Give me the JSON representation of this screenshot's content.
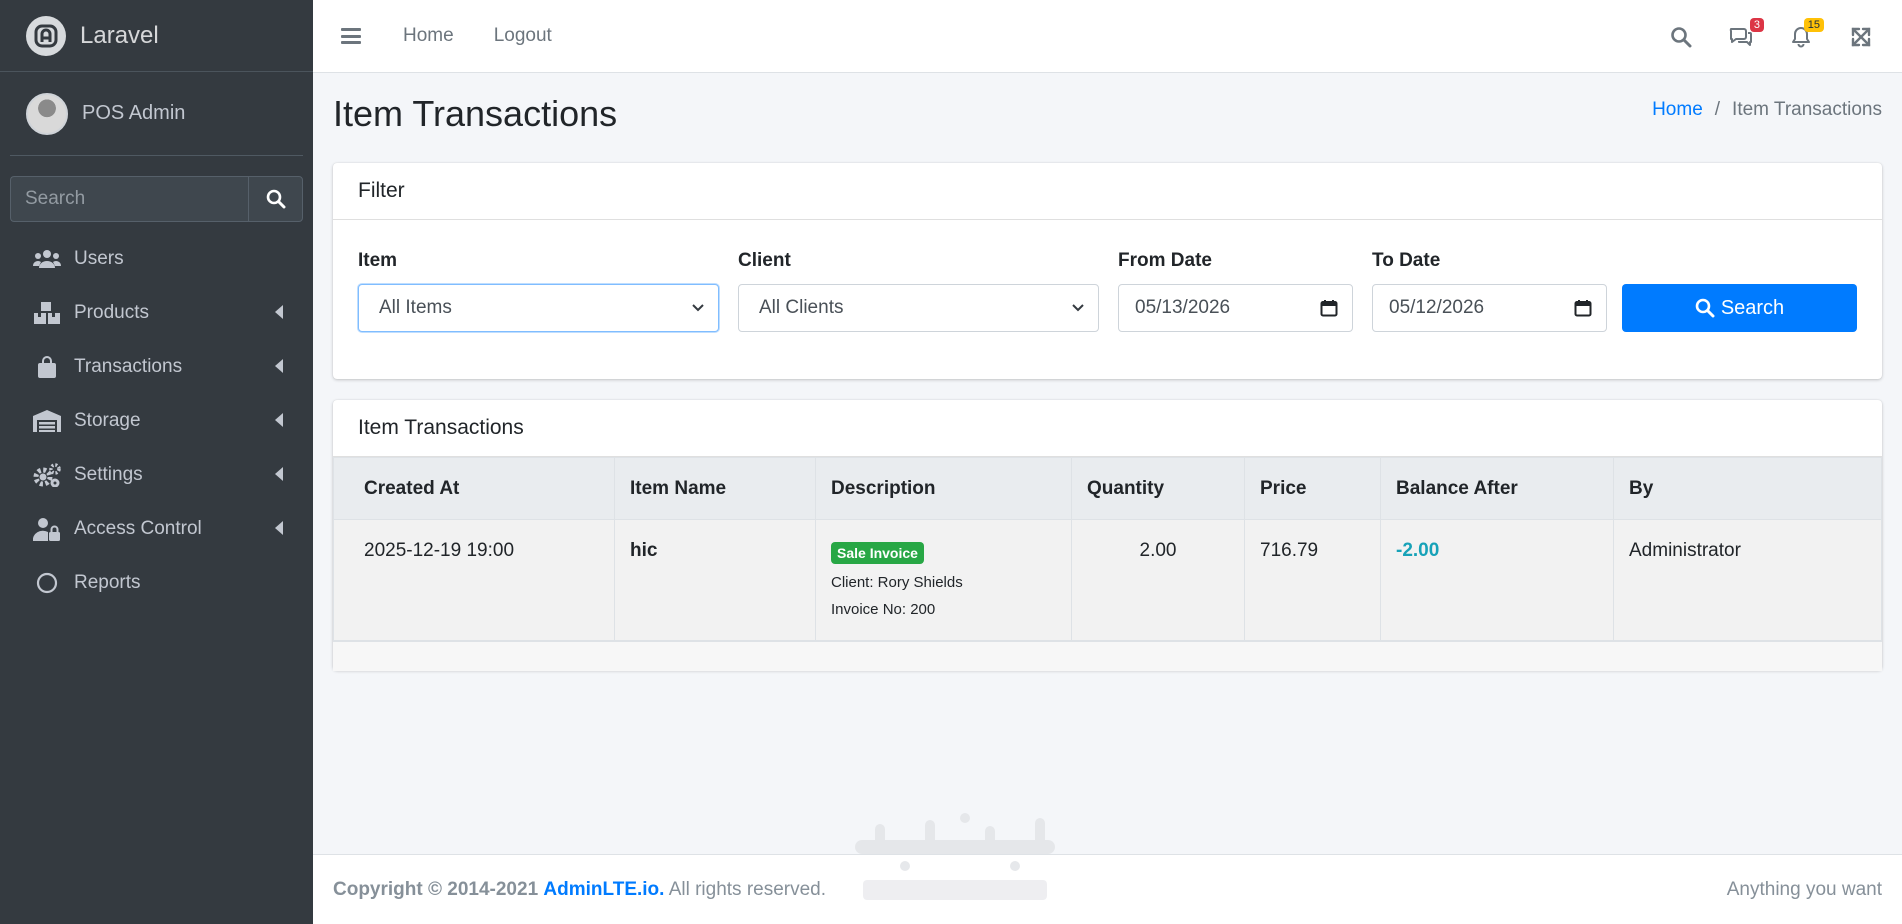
{
  "brand": {
    "name": "Laravel"
  },
  "user": {
    "name": "POS Admin"
  },
  "sidebar": {
    "search_placeholder": "Search",
    "items": [
      {
        "label": "Users",
        "icon": "users-icon",
        "has_arrow": false
      },
      {
        "label": "Products",
        "icon": "boxes-icon",
        "has_arrow": true
      },
      {
        "label": "Transactions",
        "icon": "shopping-bag-icon",
        "has_arrow": true
      },
      {
        "label": "Storage",
        "icon": "warehouse-icon",
        "has_arrow": true
      },
      {
        "label": "Settings",
        "icon": "cogs-icon",
        "has_arrow": true
      },
      {
        "label": "Access Control",
        "icon": "user-lock-icon",
        "has_arrow": true
      },
      {
        "label": "Reports",
        "icon": "circle-icon",
        "has_arrow": false
      }
    ]
  },
  "topbar": {
    "links": [
      "Home",
      "Logout"
    ],
    "messages_count": "3",
    "notifications_count": "15"
  },
  "page": {
    "title": "Item Transactions",
    "breadcrumb": [
      "Home",
      "Item Transactions"
    ]
  },
  "filter": {
    "header": "Filter",
    "item_label": "Item",
    "item_value": "All Items",
    "client_label": "Client",
    "client_value": "All Clients",
    "from_label": "From Date",
    "from_value": "05/13/2026",
    "to_label": "To Date",
    "to_value": "05/12/2026",
    "search_label": "Search"
  },
  "transactions": {
    "header": "Item Transactions",
    "columns": [
      "Created At",
      "Item Name",
      "Description",
      "Quantity",
      "Price",
      "Balance After",
      "By"
    ],
    "rows": [
      {
        "created_at": "2025-12-19 19:00",
        "item_name": "hic",
        "badge": "Sale Invoice",
        "client": "Client: Rory Shields",
        "invoice": "Invoice No: 200",
        "quantity": "2.00",
        "price": "716.79",
        "balance_after": "-2.00",
        "by": "Administrator"
      }
    ]
  },
  "footer": {
    "copyright": "Copyright © 2014-2021",
    "link": "AdminLTE.io.",
    "rights": "All rights reserved.",
    "right_text": "Anything you want"
  },
  "colors": {
    "sidebar_bg": "#343a40",
    "primary": "#007bff",
    "success_badge": "#28a745",
    "info_text": "#17a2b8",
    "danger_badge": "#dc3545",
    "warning_badge": "#ffc107"
  }
}
